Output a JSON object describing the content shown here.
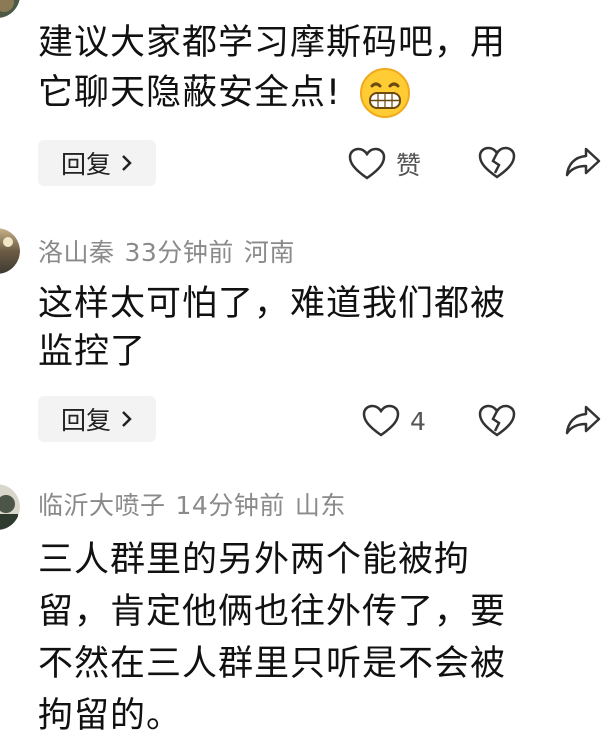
{
  "comments": [
    {
      "text_lines": [
        "建议大家都学习摩斯码吧，用",
        "它聊天隐蔽安全点!"
      ],
      "emoji": "grinning-face-emoji",
      "reply_label": "回复",
      "like_label": "赞"
    },
    {
      "author": "洛山秦",
      "time": "33分钟前",
      "location": "河南",
      "text_lines": [
        "这样太可怕了，难道我们都被",
        "监控了"
      ],
      "reply_label": "回复",
      "like_count": "4"
    },
    {
      "author": "临沂大喷子",
      "time": "14分钟前",
      "location": "山东",
      "text_lines": [
        "三人群里的另外两个能被拘",
        "留，肯定他俩也往外传了，要",
        "不然在三人群里只听是不会被",
        "拘留的。"
      ]
    }
  ],
  "icons": {
    "like": "heart-outline-icon",
    "dislike": "broken-heart-icon",
    "share": "share-arrow-icon",
    "reply_chevron": "chevron-right-icon"
  },
  "colors": {
    "meta_text": "#8a8a8a",
    "reply_bg": "#f3f3f3"
  }
}
